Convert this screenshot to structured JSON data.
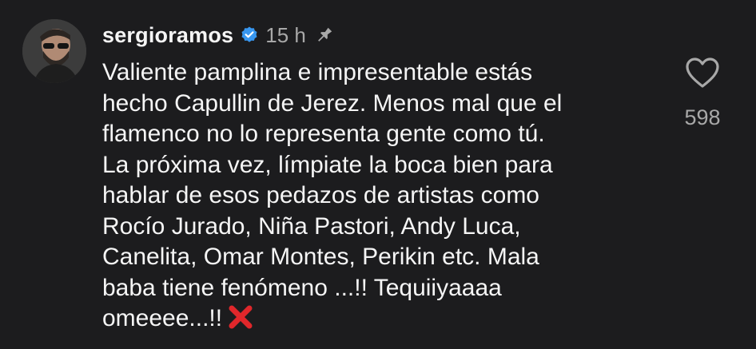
{
  "comment": {
    "username": "sergioramos",
    "verified_icon": "verified-badge-icon",
    "time": "15 h",
    "pin_icon": "pin-icon",
    "text": "Valiente pamplina e impresentable estás\nhecho Capullin de Jerez. Menos mal que el\nflamenco no lo representa gente como tú.\nLa próxima vez, límpiate la boca bien para\nhablar de esos pedazos de artistas como\nRocío Jurado, Niña Pastori, Andy Luca,\nCanelita, Omar Montes, Perikin etc. Mala\nbaba tiene fenómeno ...!! Tequiiyaaaa\nomeeee...!!",
    "emoji": "cross-mark-icon",
    "like_icon": "heart-outline-icon",
    "like_count": "598"
  },
  "colors": {
    "background": "#1c1c1e",
    "text": "#f5f5f5",
    "muted": "#a8a8a8",
    "verified": "#3897f0",
    "cross": "#e0272b"
  }
}
